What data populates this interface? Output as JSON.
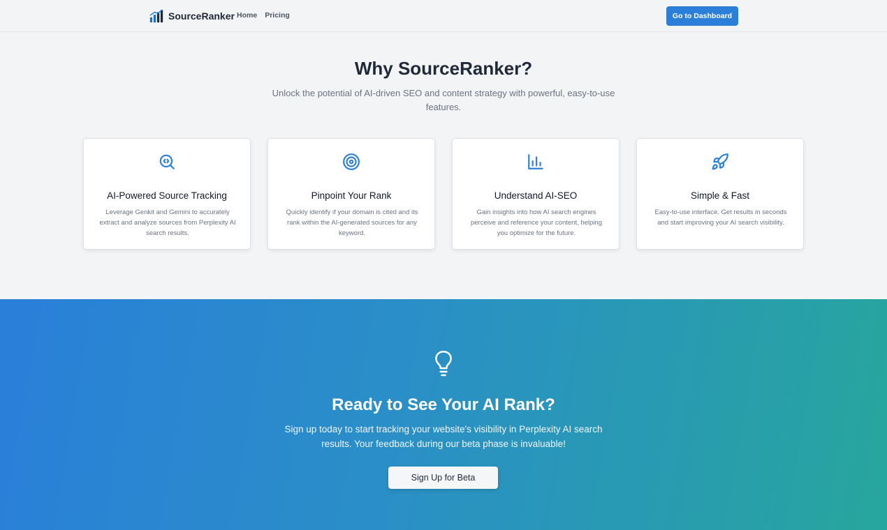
{
  "header": {
    "brand_name": "SourceRanker",
    "nav": [
      "Home",
      "Pricing"
    ],
    "dashboard_button": "Go to Dashboard"
  },
  "features": {
    "title": "Why SourceRanker?",
    "subtitle": "Unlock the potential of AI-driven SEO and content strategy with powerful, easy-to-use features.",
    "cards": [
      {
        "icon": "search-code-icon",
        "title": "AI-Powered Source Tracking",
        "description": "Leverage Genkit and Gemini to accurately extract and analyze sources from Perplexity AI search results."
      },
      {
        "icon": "target-icon",
        "title": "Pinpoint Your Rank",
        "description": "Quickly identify if your domain is cited and its rank within the AI-generated sources for any keyword."
      },
      {
        "icon": "bar-chart-icon",
        "title": "Understand AI-SEO",
        "description": "Gain insights into how AI search engines perceive and reference your content, helping you optimize for the future."
      },
      {
        "icon": "rocket-icon",
        "title": "Simple & Fast",
        "description": "Easy-to-use interface. Get results in seconds and start improving your AI search visibility."
      }
    ]
  },
  "cta": {
    "icon": "lightbulb-icon",
    "title": "Ready to See Your AI Rank?",
    "subtitle": "Sign up today to start tracking your website's visibility in Perplexity AI search results. Your feedback during our beta phase is invaluable!",
    "button": "Sign Up for Beta"
  },
  "colors": {
    "accent": "#2b7fd8",
    "gradient_start": "#2a7fd9",
    "gradient_end": "#27a69d"
  }
}
